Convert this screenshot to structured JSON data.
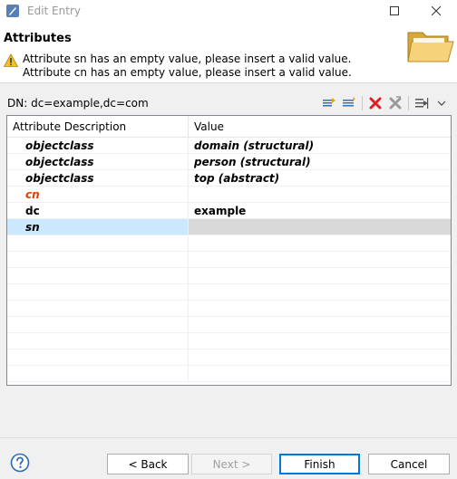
{
  "window": {
    "title": "Edit Entry",
    "maximize_icon": "maximize-icon",
    "close_icon": "close-icon"
  },
  "header": {
    "section_title": "Attributes",
    "warning": "Attribute sn has an empty value, please insert a valid value. Attribute cn has an empty value, please insert a valid value.",
    "warning_icon": "warning-icon",
    "folder_icon": "folder-icon"
  },
  "dn": {
    "label": "DN: dc=example,dc=com"
  },
  "toolbar": {
    "icons": [
      "add-value-icon",
      "edit-value-icon",
      "delete-icon",
      "delete-all-icon",
      "expand-icon",
      "dropdown-icon"
    ]
  },
  "table": {
    "headers": [
      "Attribute Description",
      "Value"
    ],
    "rows": [
      {
        "attribute": "objectclass",
        "value": "domain (structural)"
      },
      {
        "attribute": "objectclass",
        "value": "person (structural)"
      },
      {
        "attribute": "objectclass",
        "value": "top (abstract)"
      },
      {
        "attribute": "cn",
        "value": ""
      },
      {
        "attribute": "dc",
        "value": "example"
      },
      {
        "attribute": "sn",
        "value": ""
      }
    ]
  },
  "buttons": {
    "back": "< Back",
    "next": "Next >",
    "finish": "Finish",
    "cancel": "Cancel"
  },
  "colors": {
    "error_text": "#e03c00",
    "selection": "#cce8ff",
    "default_button_border": "#0078d7"
  }
}
